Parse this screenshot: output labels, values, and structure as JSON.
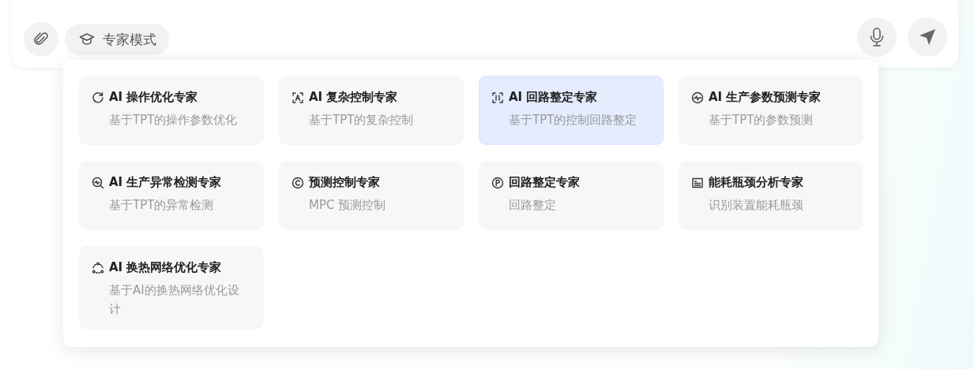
{
  "toolbar": {
    "mode_chip": {
      "label": "专家模式"
    }
  },
  "experts": [
    {
      "kind": "refresh",
      "title": "AI 操作优化专家",
      "description": "基于TPT的操作参数优化",
      "selected": false
    },
    {
      "kind": "scan-text",
      "title": "AI 复杂控制专家",
      "description": "基于TPT的复杂控制",
      "selected": false
    },
    {
      "kind": "scan",
      "title": "AI 回路整定专家",
      "description": "基于TPT的控制回路整定",
      "selected": true
    },
    {
      "kind": "pulse",
      "title": "AI 生产参数预测专家",
      "description": "基于TPT的参数预测",
      "selected": false
    },
    {
      "kind": "search-pulse",
      "title": "AI 生产异常检测专家",
      "description": "基于TPT的异常检测",
      "selected": false
    },
    {
      "kind": "circle-c",
      "title": "预测控制专家",
      "description": "MPC 预测控制",
      "selected": false
    },
    {
      "kind": "circle-p",
      "title": "回路整定专家",
      "description": "回路整定",
      "selected": false
    },
    {
      "kind": "card",
      "title": "能耗瓶颈分析专家",
      "description": "识别装置能耗瓶颈",
      "selected": false
    },
    {
      "kind": "cycle",
      "title": "AI 换热网络优化专家",
      "description": "基于AI的换热网络优化设计",
      "selected": false
    }
  ]
}
